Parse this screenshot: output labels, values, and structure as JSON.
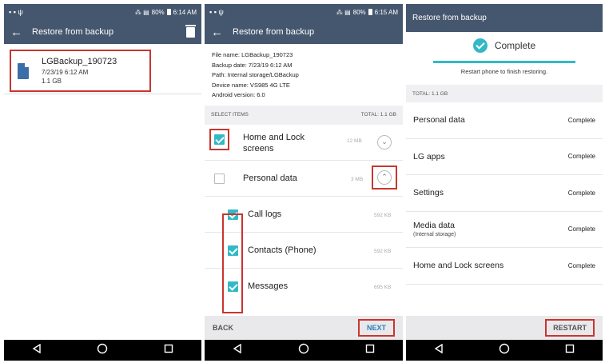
{
  "status": {
    "screen1": {
      "battery": "80%",
      "time": "6:14 AM"
    },
    "screen2": {
      "battery": "80%",
      "time": "6:15 AM"
    }
  },
  "screen1": {
    "title": "Restore from backup",
    "backup": {
      "name": "LGBackup_190723",
      "date": "7/23/19 6:12 AM",
      "size": "1.1 GB"
    }
  },
  "screen2": {
    "title": "Restore from backup",
    "info": [
      "File name: LGBackup_190723",
      "Backup date: 7/23/19 6:12 AM",
      "Path: Internal storage/LGBackup",
      "Device name: VS985 4G LTE",
      "Android version: 6.0"
    ],
    "select_items": "SELECT ITEMS",
    "total": "TOTAL: 1.1 GB",
    "items": [
      {
        "label_line1": "Home and Lock",
        "label_line2": "screens",
        "size": "12 MB",
        "checked": true
      },
      {
        "label": "Personal data",
        "size": "3 MB",
        "checked": false
      },
      {
        "label": "Call logs",
        "size": "592 KB",
        "checked": true
      },
      {
        "label": "Contacts (Phone)",
        "size": "592 KB",
        "checked": true
      },
      {
        "label": "Messages",
        "size": "695 KB",
        "checked": true
      }
    ],
    "back_label": "BACK",
    "next_label": "NEXT"
  },
  "screen3": {
    "title": "Restore from backup",
    "complete": "Complete",
    "progress_percent": 100,
    "note": "Restart phone to finish restoring.",
    "total": "TOTAL: 1.1 GB",
    "results": [
      {
        "label": "Personal data",
        "status": "Complete"
      },
      {
        "label": "LG apps",
        "status": "Complete"
      },
      {
        "label": "Settings",
        "status": "Complete"
      },
      {
        "label": "Media data",
        "sub": "(Internal storage)",
        "status": "Complete"
      },
      {
        "label": "Home and Lock screens",
        "status": "Complete"
      }
    ],
    "restart_label": "RESTART"
  },
  "colors": {
    "appbar": "#45576e",
    "accent": "#33b9c6",
    "highlight": "#c9352e"
  },
  "icons": [
    "back-arrow-icon",
    "trash-icon",
    "file-icon",
    "check-icon",
    "chevron-down-icon",
    "chevron-up-icon",
    "nav-back-icon",
    "nav-home-icon",
    "nav-recent-icon"
  ]
}
